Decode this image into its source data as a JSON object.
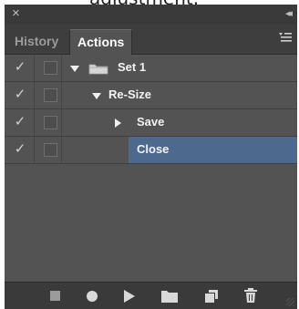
{
  "partial_text": "adjustment.",
  "titlebar": {
    "close_glyph": "×",
    "collapse_glyph": "◂◂"
  },
  "tabs": [
    {
      "label": "History",
      "active": false
    },
    {
      "label": "Actions",
      "active": true
    }
  ],
  "panel_menu_icon": "panel-menu-icon",
  "actions": [
    {
      "label": "Set 1",
      "kind": "set",
      "expanded": true,
      "checked": true,
      "selected": false
    },
    {
      "label": "Re-Size",
      "kind": "action",
      "expanded": true,
      "checked": true,
      "selected": false
    },
    {
      "label": "Save",
      "kind": "step",
      "expanded": false,
      "checked": true,
      "selected": false
    },
    {
      "label": "Close",
      "kind": "step",
      "expanded": false,
      "checked": true,
      "selected": true
    }
  ],
  "bottom_icons": [
    "stop-icon",
    "record-icon",
    "play-icon",
    "new-set-icon",
    "new-action-icon",
    "trash-icon"
  ],
  "colors": {
    "panel_bg": "#535353",
    "tab_bar_bg": "#3e3e3e",
    "selection": "#4d6a8e",
    "text": "#f2f2f2"
  }
}
